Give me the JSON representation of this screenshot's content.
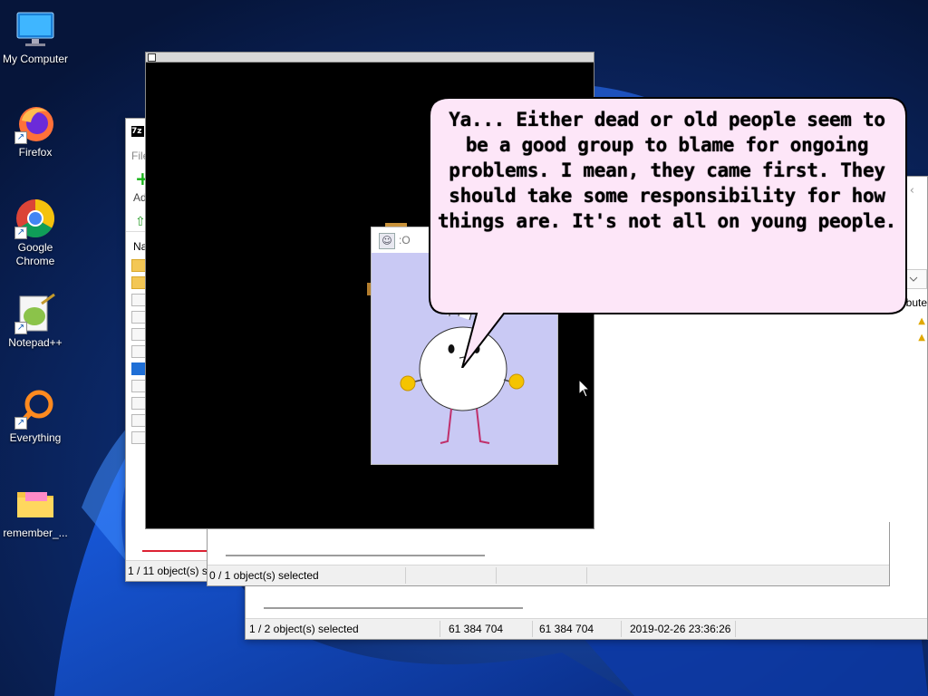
{
  "desktop": {
    "icons": [
      {
        "label": "My Computer",
        "icon": "monitor-icon",
        "shortcut": false
      },
      {
        "label": "Firefox",
        "icon": "firefox-icon",
        "shortcut": true
      },
      {
        "label": "Google Chrome",
        "icon": "chrome-icon",
        "shortcut": true
      },
      {
        "label": "Notepad++",
        "icon": "notepadpp-icon",
        "shortcut": true
      },
      {
        "label": "Everything",
        "icon": "magnifier-icon",
        "shortcut": true
      },
      {
        "label": "remember_...",
        "icon": "folder-icon",
        "shortcut": false
      }
    ]
  },
  "zip_window": {
    "logo": "7z",
    "menu_fragment": "File",
    "toolbar_fragment": "Ad",
    "column_fragment": "Na",
    "status": "1 / 11 object(s) se"
  },
  "middle_window": {
    "status": "0 / 1 object(s) selected"
  },
  "back_window": {
    "column_fragment": "bute",
    "status": {
      "selection": "1 / 2 object(s) selected",
      "size": "61 384 704",
      "packed_size": "61 384 704",
      "modified": "2019-02-26 23:36:26"
    }
  },
  "character_window": {
    "title": ":O"
  },
  "speech_bubble": {
    "lines": [
      "Ya... Either dead or old people seem to",
      "be a good group to blame for ongoing",
      "problems. I mean, they came first. They",
      "should take some responsibility for how",
      "things are. It's not all on young people."
    ]
  },
  "colors": {
    "bubble_fill": "#fde6f8",
    "character_bg": "#c9c9f4",
    "character_hands": "#f5c400",
    "character_legs": "#c0306b"
  }
}
